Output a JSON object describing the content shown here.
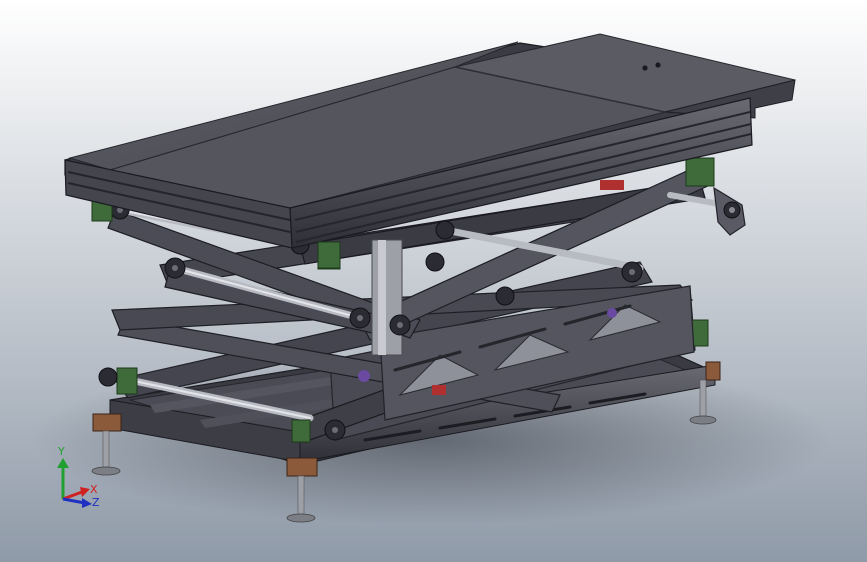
{
  "viewport": {
    "background_top": "#ffffff",
    "background_bottom": "#8f9aa8",
    "model": {
      "name": "scissor-lift-table",
      "frame_color": "#4e4e58",
      "frame_dark": "#2d2d35",
      "top_plate_color": "#55555d",
      "pivot_block_color": "#3f6b3a",
      "foot_block_color": "#8a5a3a",
      "rod_color": "#b9bbc3",
      "accent_red": "#b03030",
      "accent_purple": "#8a3aa0"
    }
  },
  "triad": {
    "x_label": "X",
    "y_label": "Y",
    "z_label": "Z",
    "x_color": "#d02020",
    "y_color": "#20a030",
    "z_color": "#2030c0"
  }
}
